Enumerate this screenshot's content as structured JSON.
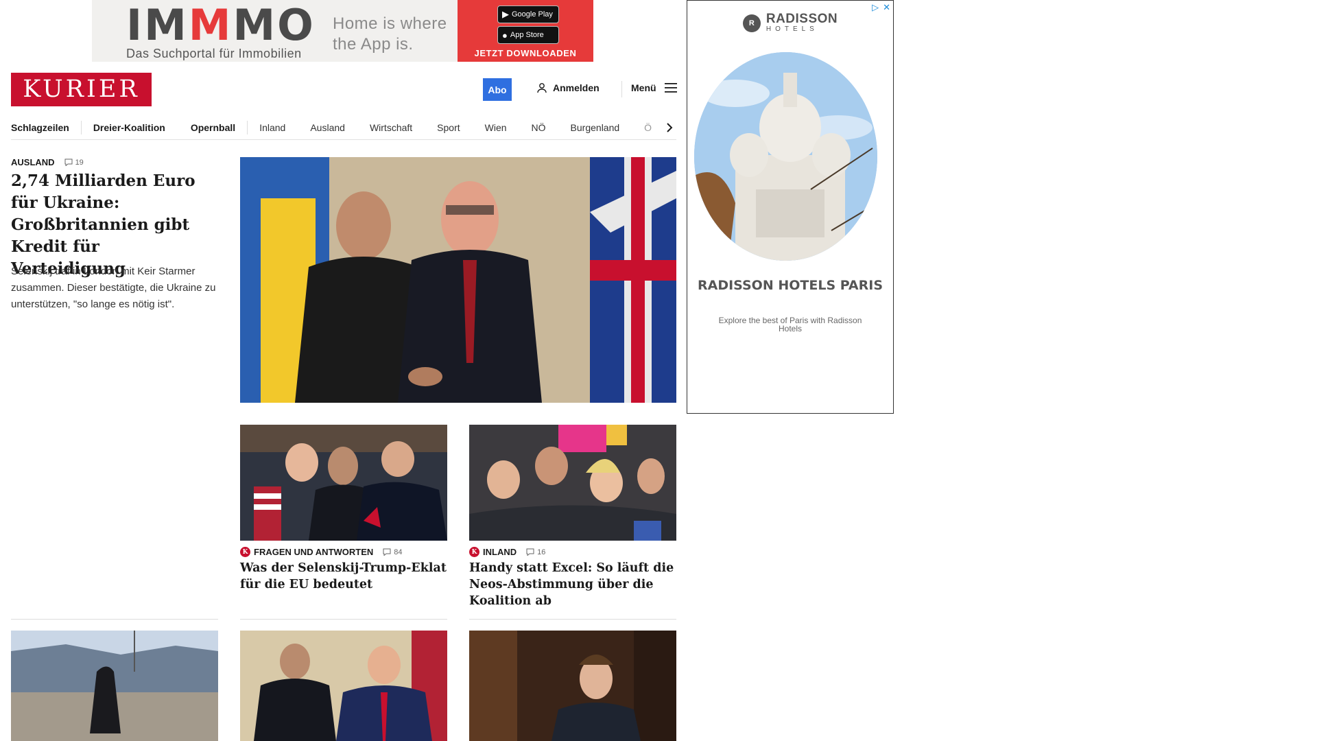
{
  "banner_ad": {
    "logo_part1": "IM",
    "logo_part2": "M",
    "logo_part3": "MO",
    "subtitle": "Das Suchportal für Immobilien",
    "tagline_line1": "Home is where",
    "tagline_line2": "the App is.",
    "google_play": "Google Play",
    "app_store": "App Store",
    "cta": "JETZT DOWNLOADEN"
  },
  "header": {
    "logo": "KURIER",
    "abo": "Abo",
    "login": "Anmelden",
    "menu": "Menü"
  },
  "nav": {
    "items": [
      "Schlagzeilen",
      "Dreier-Koalition",
      "Opernball",
      "Inland",
      "Ausland",
      "Wirtschaft",
      "Sport",
      "Wien",
      "NÖ",
      "Burgenland",
      "Ö"
    ]
  },
  "lead": {
    "category": "AUSLAND",
    "comments": "19",
    "title": "2,74 Milliarden Euro für Ukraine: Großbritannien gibt Kredit für Verteidigung",
    "teaser": "Selenskij traf in London mit Keir Starmer zusammen. Dieser bestätigte, die Ukraine zu unterstützen, \"so lange es nötig ist\"."
  },
  "cards": [
    {
      "category": "FRAGEN UND ANTWORTEN",
      "comments": "84",
      "title": "Was der Selenskij-Trump-Eklat für die EU bedeutet"
    },
    {
      "category": "INLAND",
      "comments": "16",
      "title": "Handy statt Excel: So läuft die Neos-Abstimmung über die Koalition ab"
    }
  ],
  "side_ad": {
    "brand": "RADISSON",
    "brand_sub": "HOTELS",
    "headline": "RADISSON HOTELS PARIS",
    "description": "Explore the best of Paris with Radisson Hotels"
  },
  "colors": {
    "brand_red": "#c8102e",
    "abo_blue": "#2f6fe0",
    "immo_red": "#e63a3a"
  }
}
